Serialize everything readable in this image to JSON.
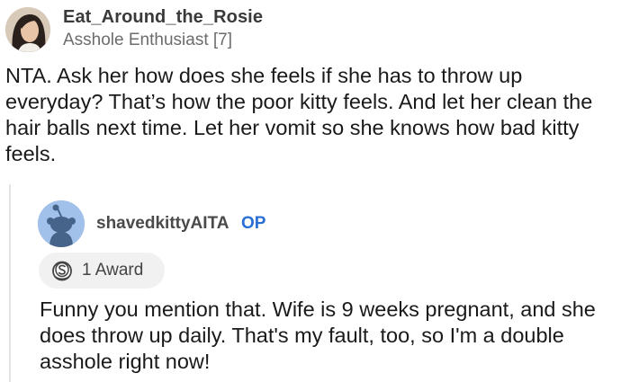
{
  "top_comment": {
    "author": "Eat_Around_the_Rosie",
    "flair": "Asshole Enthusiast [7]",
    "body": "NTA. Ask her how does she feels if she has to throw up everyday? That’s how the poor kitty feels. And let her clean the hair balls next time. Let her vomit so she knows how bad kitty feels.",
    "avatar_icon": "user-photo-avatar"
  },
  "reply": {
    "author": "shavedkittyAITA",
    "op_label": "OP",
    "award_label": "1 Award",
    "award_icon": "silver-award-icon",
    "avatar_icon": "snoo-avatar",
    "body": "Funny you mention that. Wife is 9 weeks pregnant, and she does throw up daily. That's my fault, too, so I'm a double asshole right now!"
  },
  "colors": {
    "op_blue": "#2a6fd6",
    "avatar_blue": "#a2c1ea",
    "award_pill": "#f1f1f1",
    "flair_gray": "#6c6c6c"
  }
}
